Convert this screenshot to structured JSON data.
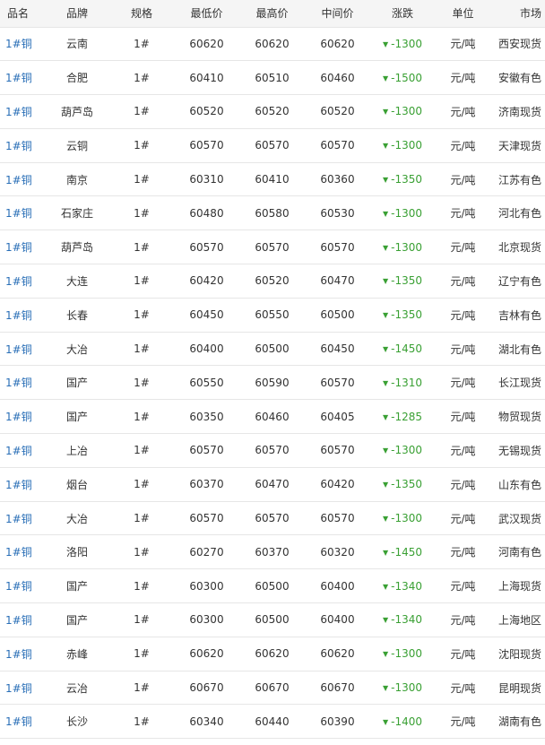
{
  "columns": {
    "name": "品名",
    "brand": "品牌",
    "spec": "规格",
    "low": "最低价",
    "high": "最高价",
    "mid": "中间价",
    "change": "涨跌",
    "unit": "单位",
    "market": "市场"
  },
  "colors": {
    "link": "#2a6fb7",
    "down": "#3aa034"
  },
  "change_icon": "down-triangle-icon",
  "rows": [
    {
      "name": "1#铜",
      "brand": "云南",
      "spec": "1#",
      "low": "60620",
      "high": "60620",
      "mid": "60620",
      "change": "-1300",
      "unit": "元/吨",
      "market": "西安现货"
    },
    {
      "name": "1#铜",
      "brand": "合肥",
      "spec": "1#",
      "low": "60410",
      "high": "60510",
      "mid": "60460",
      "change": "-1500",
      "unit": "元/吨",
      "market": "安徽有色"
    },
    {
      "name": "1#铜",
      "brand": "葫芦岛",
      "spec": "1#",
      "low": "60520",
      "high": "60520",
      "mid": "60520",
      "change": "-1300",
      "unit": "元/吨",
      "market": "济南现货"
    },
    {
      "name": "1#铜",
      "brand": "云铜",
      "spec": "1#",
      "low": "60570",
      "high": "60570",
      "mid": "60570",
      "change": "-1300",
      "unit": "元/吨",
      "market": "天津现货"
    },
    {
      "name": "1#铜",
      "brand": "南京",
      "spec": "1#",
      "low": "60310",
      "high": "60410",
      "mid": "60360",
      "change": "-1350",
      "unit": "元/吨",
      "market": "江苏有色"
    },
    {
      "name": "1#铜",
      "brand": "石家庄",
      "spec": "1#",
      "low": "60480",
      "high": "60580",
      "mid": "60530",
      "change": "-1300",
      "unit": "元/吨",
      "market": "河北有色"
    },
    {
      "name": "1#铜",
      "brand": "葫芦岛",
      "spec": "1#",
      "low": "60570",
      "high": "60570",
      "mid": "60570",
      "change": "-1300",
      "unit": "元/吨",
      "market": "北京现货"
    },
    {
      "name": "1#铜",
      "brand": "大连",
      "spec": "1#",
      "low": "60420",
      "high": "60520",
      "mid": "60470",
      "change": "-1350",
      "unit": "元/吨",
      "market": "辽宁有色"
    },
    {
      "name": "1#铜",
      "brand": "长春",
      "spec": "1#",
      "low": "60450",
      "high": "60550",
      "mid": "60500",
      "change": "-1350",
      "unit": "元/吨",
      "market": "吉林有色"
    },
    {
      "name": "1#铜",
      "brand": "大冶",
      "spec": "1#",
      "low": "60400",
      "high": "60500",
      "mid": "60450",
      "change": "-1450",
      "unit": "元/吨",
      "market": "湖北有色"
    },
    {
      "name": "1#铜",
      "brand": "国产",
      "spec": "1#",
      "low": "60550",
      "high": "60590",
      "mid": "60570",
      "change": "-1310",
      "unit": "元/吨",
      "market": "长江现货"
    },
    {
      "name": "1#铜",
      "brand": "国产",
      "spec": "1#",
      "low": "60350",
      "high": "60460",
      "mid": "60405",
      "change": "-1285",
      "unit": "元/吨",
      "market": "物贸现货"
    },
    {
      "name": "1#铜",
      "brand": "上冶",
      "spec": "1#",
      "low": "60570",
      "high": "60570",
      "mid": "60570",
      "change": "-1300",
      "unit": "元/吨",
      "market": "无锡现货"
    },
    {
      "name": "1#铜",
      "brand": "烟台",
      "spec": "1#",
      "low": "60370",
      "high": "60470",
      "mid": "60420",
      "change": "-1350",
      "unit": "元/吨",
      "market": "山东有色"
    },
    {
      "name": "1#铜",
      "brand": "大冶",
      "spec": "1#",
      "low": "60570",
      "high": "60570",
      "mid": "60570",
      "change": "-1300",
      "unit": "元/吨",
      "market": "武汉现货"
    },
    {
      "name": "1#铜",
      "brand": "洛阳",
      "spec": "1#",
      "low": "60270",
      "high": "60370",
      "mid": "60320",
      "change": "-1450",
      "unit": "元/吨",
      "market": "河南有色"
    },
    {
      "name": "1#铜",
      "brand": "国产",
      "spec": "1#",
      "low": "60300",
      "high": "60500",
      "mid": "60400",
      "change": "-1340",
      "unit": "元/吨",
      "market": "上海现货"
    },
    {
      "name": "1#铜",
      "brand": "国产",
      "spec": "1#",
      "low": "60300",
      "high": "60500",
      "mid": "60400",
      "change": "-1340",
      "unit": "元/吨",
      "market": "上海地区"
    },
    {
      "name": "1#铜",
      "brand": "赤峰",
      "spec": "1#",
      "low": "60620",
      "high": "60620",
      "mid": "60620",
      "change": "-1300",
      "unit": "元/吨",
      "market": "沈阳现货"
    },
    {
      "name": "1#铜",
      "brand": "云冶",
      "spec": "1#",
      "low": "60670",
      "high": "60670",
      "mid": "60670",
      "change": "-1300",
      "unit": "元/吨",
      "market": "昆明现货"
    },
    {
      "name": "1#铜",
      "brand": "长沙",
      "spec": "1#",
      "low": "60340",
      "high": "60440",
      "mid": "60390",
      "change": "-1400",
      "unit": "元/吨",
      "market": "湖南有色"
    }
  ]
}
